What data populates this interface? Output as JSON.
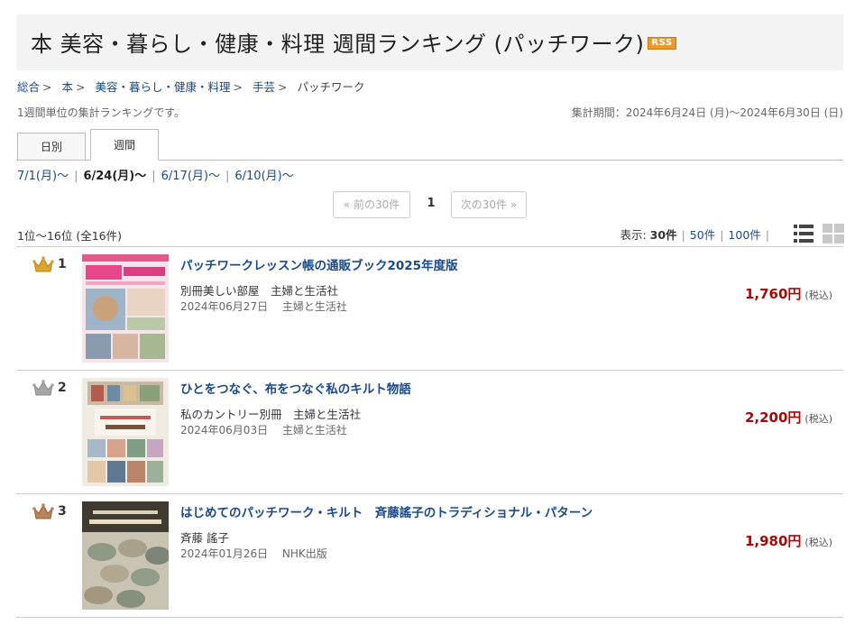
{
  "header": {
    "title": "本 美容・暮らし・健康・料理 週間ランキング (パッチワーク)",
    "rss_label": "RSS"
  },
  "breadcrumb": [
    {
      "label": "総合",
      "link": true
    },
    {
      "label": "本",
      "link": true
    },
    {
      "label": "美容・暮らし・健康・料理",
      "link": true
    },
    {
      "label": "手芸",
      "link": true
    },
    {
      "label": "パッチワーク",
      "link": false
    }
  ],
  "description": "1週間単位の集計ランキングです。",
  "period": "集計期間：2024年6月24日 (月)～2024年6月30日 (日)",
  "tabs": {
    "daily": "日別",
    "weekly": "週間"
  },
  "weeks": [
    {
      "label": "7/1(月)～",
      "selected": false
    },
    {
      "label": "6/24(月)～",
      "selected": true
    },
    {
      "label": "6/17(月)～",
      "selected": false
    },
    {
      "label": "6/10(月)～",
      "selected": false
    }
  ],
  "pager": {
    "prev": "« 前の30件",
    "current": "1",
    "next": "次の30件 »"
  },
  "count_text": "1位～16位 (全16件)",
  "display": {
    "label": "表示:",
    "options": [
      "30件",
      "50件",
      "100件"
    ],
    "selected": "30件"
  },
  "colors": {
    "link": "#1a4a8a",
    "price": "#a50a0a",
    "gold": "#d9a531",
    "silver": "#a6a6a6",
    "bronze": "#b8835a"
  },
  "items": [
    {
      "rank": "1",
      "crown": "gold-crown-icon",
      "title": "パッチワークレッスン帳の通販ブック2025年度版",
      "author": "別冊美しい部屋　主婦と生活社",
      "date": "2024年06月27日　 主婦と生活社",
      "price": "1,760円",
      "tax": "(税込)"
    },
    {
      "rank": "2",
      "crown": "silver-crown-icon",
      "title": "ひとをつなぐ、布をつなぐ私のキルト物語",
      "author": "私のカントリー別冊　主婦と生活社",
      "date": "2024年06月03日　 主婦と生活社",
      "price": "2,200円",
      "tax": "(税込)"
    },
    {
      "rank": "3",
      "crown": "bronze-crown-icon",
      "title": "はじめてのパッチワーク・キルト　斉藤謠子のトラディショナル・パターン",
      "author": "斉藤 謠子",
      "date": "2024年01月26日　 NHK出版",
      "price": "1,980円",
      "tax": "(税込)"
    }
  ]
}
